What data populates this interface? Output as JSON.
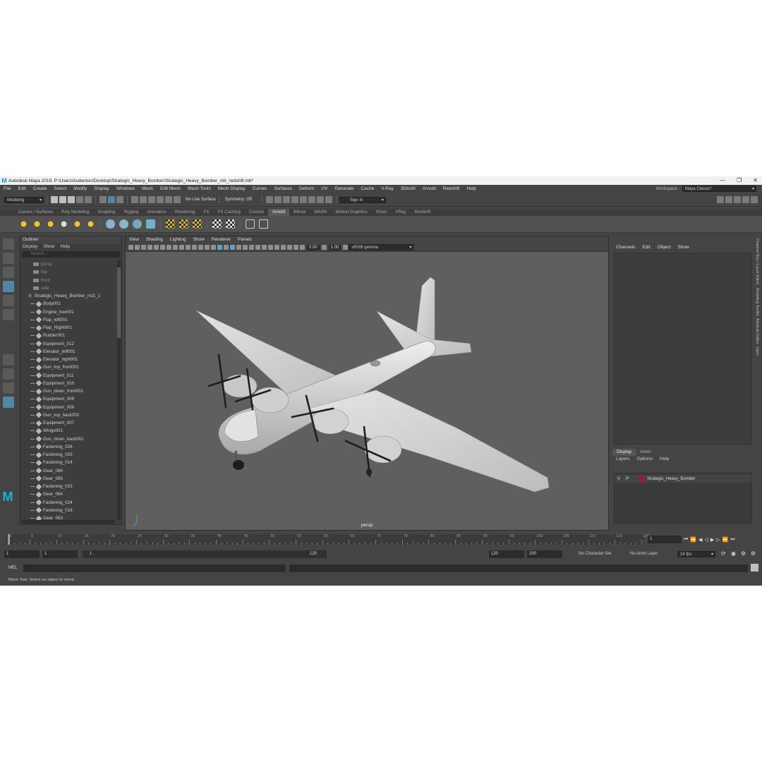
{
  "window": {
    "title": "Autodesk Maya 2018: P:\\Users\\Avdenton\\Desktop\\Strategic_Heavy_Bomber\\Strategic_Heavy_Bomber_mb_redshift.mb*",
    "logo": "M",
    "minimize": "—",
    "maximize": "❐",
    "close": "✕"
  },
  "menubar": {
    "items": [
      "File",
      "Edit",
      "Create",
      "Select",
      "Modify",
      "Display",
      "Windows",
      "Mesh",
      "Edit Mesh",
      "Mesh Tools",
      "Mesh Display",
      "Curves",
      "Surfaces",
      "Deform",
      "UV",
      "Generate",
      "Cache",
      "V-Ray",
      "3DtoAll",
      "Arnold",
      "Redshift",
      "Help"
    ],
    "workspace_label": "Workspace :",
    "workspace_value": "Maya Classic*"
  },
  "statusline": {
    "mode": "Modeling",
    "live_surface": "No Live Surface",
    "symmetry": "Symmetry: Off",
    "sign_in": "Sign In"
  },
  "shelf": {
    "tabs": [
      "Curves / Surfaces",
      "Poly Modeling",
      "Sculpting",
      "Rigging",
      "Animation",
      "Rendering",
      "FX",
      "FX Caching",
      "Custom",
      "Arnold",
      "Bifrost",
      "MASH",
      "Motion Graphics",
      "XGen",
      "VRay",
      "Redshift"
    ],
    "active_tab": "Arnold"
  },
  "outliner": {
    "title": "Outliner",
    "menu": [
      "Display",
      "Show",
      "Help"
    ],
    "search_placeholder": "Search...",
    "cameras": [
      "persp",
      "top",
      "front",
      "side"
    ],
    "group": "Strategic_Heavy_Bomber_ncl1_1",
    "children": [
      "Body001",
      "Engine_box001",
      "Flap_left001",
      "Flap_Right001",
      "Rudder001",
      "Equipment_012",
      "Elevator_left001",
      "Elevator_right001",
      "Gun_top_front001",
      "Equipment_011",
      "Equipment_010",
      "Gun_down_front001",
      "Equipment_009",
      "Equipment_008",
      "Gun_top_back001",
      "Equipment_007",
      "Wings001",
      "Gun_down_back001",
      "Fastening_026",
      "Fastening_025",
      "Fastening_014",
      "Gear_086",
      "Gear_085",
      "Fastening_015",
      "Gear_084",
      "Fastening_024",
      "Fastening_016",
      "Gear_083"
    ]
  },
  "viewport": {
    "menu": [
      "View",
      "Shading",
      "Lighting",
      "Show",
      "Renderer",
      "Panels"
    ],
    "value_a": "0.00",
    "value_b": "1.00",
    "color_space": "sRGB gamma",
    "camera_label": "persp"
  },
  "channelbox": {
    "menu": [
      "Channels",
      "Edit",
      "Object",
      "Show"
    ],
    "side_tabs": [
      "Channel Box / Layer Editor",
      "Modeling Toolkit",
      "Attribute Editor",
      "Xgen"
    ]
  },
  "layer_editor": {
    "tabs": [
      "Display",
      "Anim"
    ],
    "active_tab": "Display",
    "menu": [
      "Layers",
      "Options",
      "Help"
    ],
    "layer": {
      "v": "V",
      "p": "P",
      "name": "Strategic_Heavy_Bomber",
      "color": "#a0192e"
    }
  },
  "timeline": {
    "ticks": [
      "1",
      "5",
      "10",
      "15",
      "20",
      "25",
      "30",
      "35",
      "40",
      "45",
      "50",
      "55",
      "60",
      "65",
      "70",
      "75",
      "80",
      "85",
      "90",
      "95",
      "100",
      "105",
      "110",
      "115",
      "120"
    ],
    "current_frame": "1"
  },
  "range": {
    "start": "1",
    "playback_start": "1",
    "range_start_label": "1",
    "range_end_label": "120",
    "playback_end": "120",
    "end": "200",
    "character_set": "No Character Set",
    "anim_layer": "No Anim Layer",
    "fps": "24 fps"
  },
  "command": {
    "label": "MEL"
  },
  "helpline": {
    "text": "Move Tool: Select an object to move."
  },
  "colors": {
    "ui_bg": "#444444",
    "viewport_bg": "#5f5f5f",
    "accent": "#5285a6",
    "maya_logo": "#0a9ad6"
  }
}
